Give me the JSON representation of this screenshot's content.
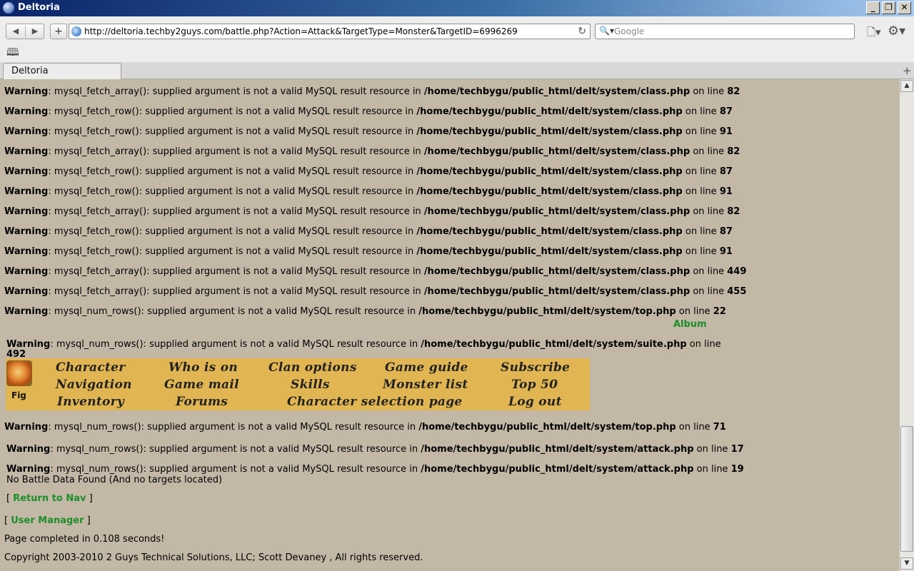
{
  "window": {
    "title": "Deltoria",
    "minimize": "_",
    "restore": "❐",
    "close": "✕"
  },
  "toolbar": {
    "back": "◀",
    "forward": "▶",
    "add": "+",
    "url": "http://deltoria.techby2guys.com/battle.php?Action=Attack&TargetType=Monster&TargetID=6996269",
    "reload": "↻",
    "search_placeholder": "Google",
    "search_icon": "🔍▾",
    "page_icon": "🗋▾",
    "gear_icon": "⚙▾",
    "bookmarks_icon": "🕮"
  },
  "tabs": [
    {
      "label": "Deltoria"
    }
  ],
  "new_tab": "+",
  "warnings_top": [
    {
      "label": "Warning",
      "text": ": mysql_fetch_array(): supplied argument is not a valid MySQL result resource in ",
      "path": "/home/techbygu/public_html/delt/system/class.php",
      "online": " on line ",
      "line": "82"
    },
    {
      "label": "Warning",
      "text": ": mysql_fetch_row(): supplied argument is not a valid MySQL result resource in ",
      "path": "/home/techbygu/public_html/delt/system/class.php",
      "online": " on line ",
      "line": "87"
    },
    {
      "label": "Warning",
      "text": ": mysql_fetch_row(): supplied argument is not a valid MySQL result resource in ",
      "path": "/home/techbygu/public_html/delt/system/class.php",
      "online": " on line ",
      "line": "91"
    },
    {
      "label": "Warning",
      "text": ": mysql_fetch_array(): supplied argument is not a valid MySQL result resource in ",
      "path": "/home/techbygu/public_html/delt/system/class.php",
      "online": " on line ",
      "line": "82"
    },
    {
      "label": "Warning",
      "text": ": mysql_fetch_row(): supplied argument is not a valid MySQL result resource in ",
      "path": "/home/techbygu/public_html/delt/system/class.php",
      "online": " on line ",
      "line": "87"
    },
    {
      "label": "Warning",
      "text": ": mysql_fetch_row(): supplied argument is not a valid MySQL result resource in ",
      "path": "/home/techbygu/public_html/delt/system/class.php",
      "online": " on line ",
      "line": "91"
    },
    {
      "label": "Warning",
      "text": ": mysql_fetch_array(): supplied argument is not a valid MySQL result resource in ",
      "path": "/home/techbygu/public_html/delt/system/class.php",
      "online": " on line ",
      "line": "82"
    },
    {
      "label": "Warning",
      "text": ": mysql_fetch_row(): supplied argument is not a valid MySQL result resource in ",
      "path": "/home/techbygu/public_html/delt/system/class.php",
      "online": " on line ",
      "line": "87"
    },
    {
      "label": "Warning",
      "text": ": mysql_fetch_row(): supplied argument is not a valid MySQL result resource in ",
      "path": "/home/techbygu/public_html/delt/system/class.php",
      "online": " on line ",
      "line": "91"
    },
    {
      "label": "Warning",
      "text": ": mysql_fetch_array(): supplied argument is not a valid MySQL result resource in ",
      "path": "/home/techbygu/public_html/delt/system/class.php",
      "online": " on line ",
      "line": "449"
    },
    {
      "label": "Warning",
      "text": ": mysql_fetch_array(): supplied argument is not a valid MySQL result resource in ",
      "path": "/home/techbygu/public_html/delt/system/class.php",
      "online": " on line ",
      "line": "455"
    },
    {
      "label": "Warning",
      "text": ": mysql_num_rows(): supplied argument is not a valid MySQL result resource in ",
      "path": "/home/techbygu/public_html/delt/system/top.php",
      "online": " on line ",
      "line": "22"
    }
  ],
  "album_link": "Album",
  "suite_warning": {
    "label": "Warning",
    "text": ": mysql_num_rows(): supplied argument is not a valid MySQL result resource in ",
    "path": "/home/techbygu/public_html/delt/system/suite.php",
    "online": " on line",
    "line": "492"
  },
  "nav": {
    "avatar_label": "Fig",
    "links": [
      "Character",
      "Who is on",
      "Clan options",
      "Game guide",
      "Subscribe",
      "Navigation",
      "Game mail",
      "Skills",
      "Monster list",
      "Top 50",
      "Inventory",
      "Forums",
      "Character selection page",
      "Log out"
    ]
  },
  "warnings_bottom": [
    {
      "label": "Warning",
      "text": ": mysql_num_rows(): supplied argument is not a valid MySQL result resource in ",
      "path": "/home/techbygu/public_html/delt/system/top.php",
      "online": " on line ",
      "line": "71"
    },
    {
      "label": "Warning",
      "text": ": mysql_num_rows(): supplied argument is not a valid MySQL result resource in ",
      "path": "/home/techbygu/public_html/delt/system/attack.php",
      "online": " on line ",
      "line": "17"
    },
    {
      "label": "Warning",
      "text": ": mysql_num_rows(): supplied argument is not a valid MySQL result resource in ",
      "path": "/home/techbygu/public_html/delt/system/attack.php",
      "online": " on line ",
      "line": "19"
    }
  ],
  "no_battle": "No Battle Data Found (And no targets located)",
  "return_nav": {
    "open": "[ ",
    "label": "Return to Nav",
    "close": " ]"
  },
  "user_manager": {
    "open": "[ ",
    "label": "User Manager",
    "close": " ]"
  },
  "page_completed": "Page completed in 0.108 seconds!",
  "copyright": "Copyright 2003-2010 2 Guys Technical Solutions, LLC; Scott Devaney , All rights reserved.",
  "scrollbar": {
    "up": "▲",
    "down": "▼"
  }
}
